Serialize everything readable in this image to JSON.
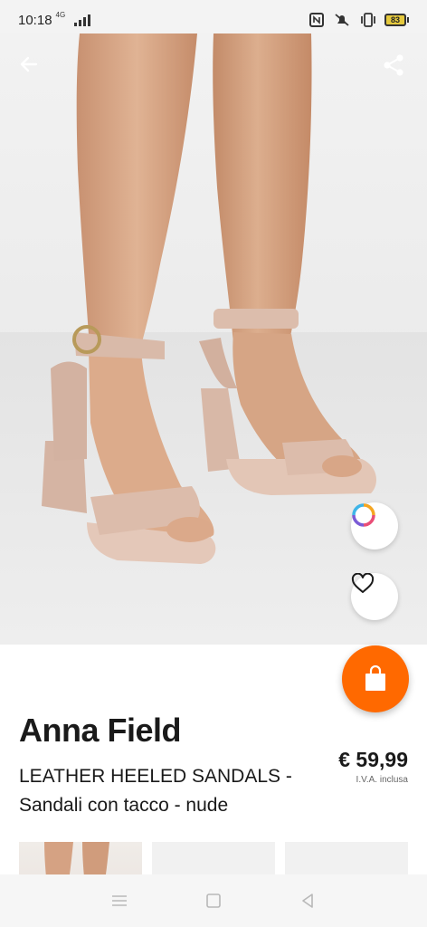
{
  "status_bar": {
    "time": "10:18",
    "network": "4G",
    "battery": "83",
    "icons": [
      "nfc-icon",
      "mute-icon",
      "vibrate-icon",
      "battery-icon"
    ]
  },
  "toolbar": {
    "back_icon": "arrow-left-icon",
    "share_icon": "share-icon"
  },
  "actions": {
    "ring_icon": "color-ring-icon",
    "favorite_icon": "heart-outline-icon",
    "cart_icon": "shopping-bag-icon",
    "cart_color": "#ff6900"
  },
  "product": {
    "brand": "Anna Field",
    "name": "LEATHER HEELED SANDALS - Sandali con tacco - nude",
    "price": "€ 59,99",
    "vat_note": "I.V.A. inclusa"
  },
  "thumbnails": [
    {
      "icon": "product-thumbnail-legs"
    },
    {
      "icon": "product-thumbnail-blank"
    },
    {
      "icon": "product-thumbnail-blank"
    }
  ],
  "nav_bar": {
    "icons": [
      "menu-icon",
      "home-square-icon",
      "back-triangle-icon"
    ]
  }
}
